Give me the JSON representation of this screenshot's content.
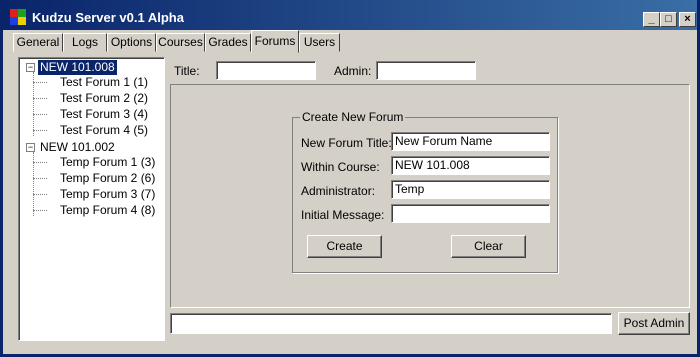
{
  "window": {
    "title": "Kudzu Server v0.1 Alpha",
    "controls": {
      "minimize": "_",
      "maximize": "□",
      "close": "×"
    }
  },
  "tabs": [
    {
      "label": "General"
    },
    {
      "label": "Logs"
    },
    {
      "label": "Options"
    },
    {
      "label": "Courses"
    },
    {
      "label": "Grades"
    },
    {
      "label": "Forums",
      "active": true
    },
    {
      "label": "Users"
    }
  ],
  "tree": {
    "courses": [
      {
        "label": "NEW 101.008",
        "selected": true,
        "expanded": true,
        "forums": [
          "Test Forum 1 (1)",
          "Test Forum 2 (2)",
          "Test Forum 3 (4)",
          "Test Forum 4 (5)"
        ]
      },
      {
        "label": "NEW 101.002",
        "selected": false,
        "expanded": true,
        "forums": [
          "Temp Forum 1 (3)",
          "Temp Forum 2 (6)",
          "Temp Forum 3 (7)",
          "Temp Forum 4 (8)"
        ]
      }
    ]
  },
  "filter": {
    "title_label": "Title:",
    "title_value": "",
    "admin_label": "Admin:",
    "admin_value": ""
  },
  "create_forum": {
    "group_title": "Create New Forum",
    "new_forum_title_label": "New Forum Title:",
    "new_forum_title_value": "New Forum Name",
    "within_course_label": "Within Course:",
    "within_course_value": "NEW 101.008",
    "administrator_label": "Administrator:",
    "administrator_value": "Temp",
    "initial_message_label": "Initial Message:",
    "initial_message_value": "",
    "create_label": "Create",
    "clear_label": "Clear"
  },
  "bottom": {
    "message_value": "",
    "post_admin_label": "Post Admin"
  }
}
